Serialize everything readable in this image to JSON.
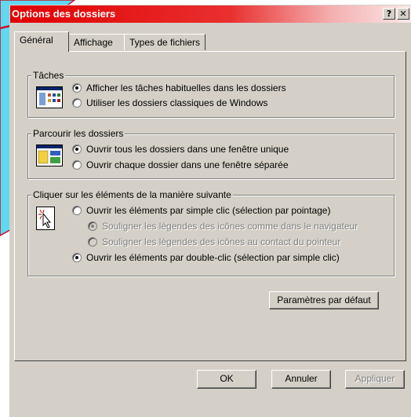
{
  "window": {
    "title": "Options des dossiers",
    "help_label": "?",
    "close_label": "✕"
  },
  "tabs": [
    {
      "label": "Général",
      "active": true
    },
    {
      "label": "Affichage",
      "active": false
    },
    {
      "label": "Types de fichiers",
      "active": false
    }
  ],
  "groups": {
    "taches": {
      "title": "Tâches",
      "icon": "tasks-folder-icon",
      "options": [
        {
          "label": "Afficher les tâches habituelles dans les dossiers",
          "checked": true
        },
        {
          "label": "Utiliser les dossiers classiques de Windows",
          "checked": false
        }
      ]
    },
    "parcourir": {
      "title": "Parcourir les dossiers",
      "icon": "browse-window-icon",
      "options": [
        {
          "label": "Ouvrir tous les dossiers dans une fenêtre unique",
          "checked": true
        },
        {
          "label": "Ouvrir chaque dossier dans une fenêtre séparée",
          "checked": false
        }
      ]
    },
    "cliquer": {
      "title": "Cliquer sur les éléments de la manière suivante",
      "icon": "click-cursor-icon",
      "options": [
        {
          "label": "Ouvrir les éléments par simple clic (sélection par pointage)",
          "checked": false
        },
        {
          "label": "Souligner les légendes des icônes comme dans le navigateur",
          "checked": true,
          "disabled": true
        },
        {
          "label": "Souligner les légendes des icônes au contact du pointeur",
          "checked": false,
          "disabled": true
        },
        {
          "label": "Ouvrir les éléments par double-clic (sélection par simple clic)",
          "checked": true
        }
      ]
    }
  },
  "buttons": {
    "defaults": "Paramètres par défaut",
    "ok": "OK",
    "cancel": "Annuler",
    "apply": "Appliquer"
  },
  "colors": {
    "titlebar": "#e10000",
    "dialog_bg": "#d4d0c8",
    "annotation": "#c8102e",
    "decor_fill": "#5fd8f0"
  }
}
